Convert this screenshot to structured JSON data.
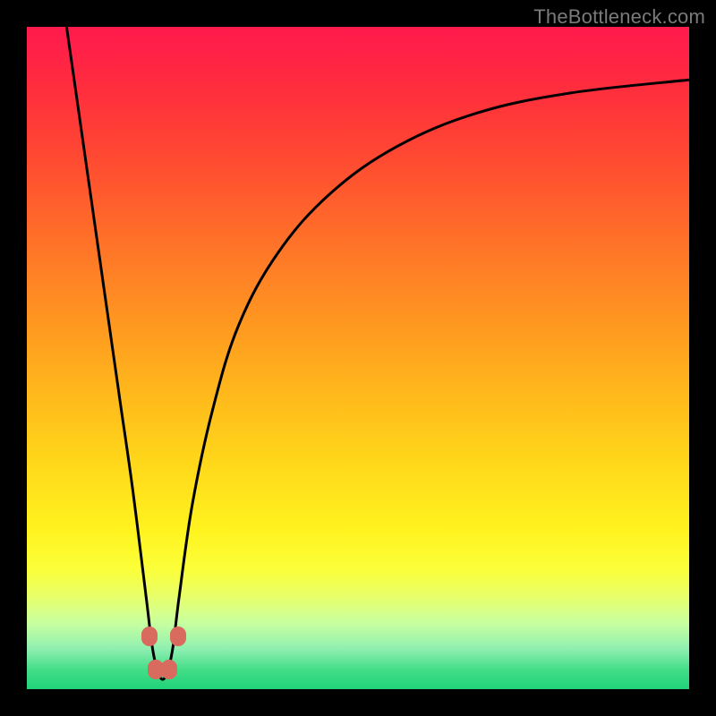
{
  "watermark": "TheBottleneck.com",
  "chart_data": {
    "type": "line",
    "title": "",
    "xlabel": "",
    "ylabel": "",
    "xlim": [
      0,
      100
    ],
    "ylim": [
      0,
      100
    ],
    "grid": false,
    "series": [
      {
        "name": "curve",
        "x": [
          6,
          8,
          10,
          12,
          14,
          16,
          18,
          19,
          20,
          21,
          22,
          23,
          25,
          28,
          32,
          38,
          46,
          56,
          68,
          82,
          100
        ],
        "y": [
          100,
          86,
          72,
          58,
          44,
          30,
          14,
          6,
          2,
          2,
          6,
          14,
          28,
          42,
          55,
          66,
          75,
          82,
          87,
          90,
          92
        ]
      }
    ],
    "markers": [
      {
        "x": 18.5,
        "y": 8
      },
      {
        "x": 19.5,
        "y": 3
      },
      {
        "x": 21.5,
        "y": 3
      },
      {
        "x": 22.8,
        "y": 8
      }
    ],
    "gradient_background": {
      "top_color": "#ff1a4d",
      "bottom_color": "#1fd37a"
    }
  }
}
